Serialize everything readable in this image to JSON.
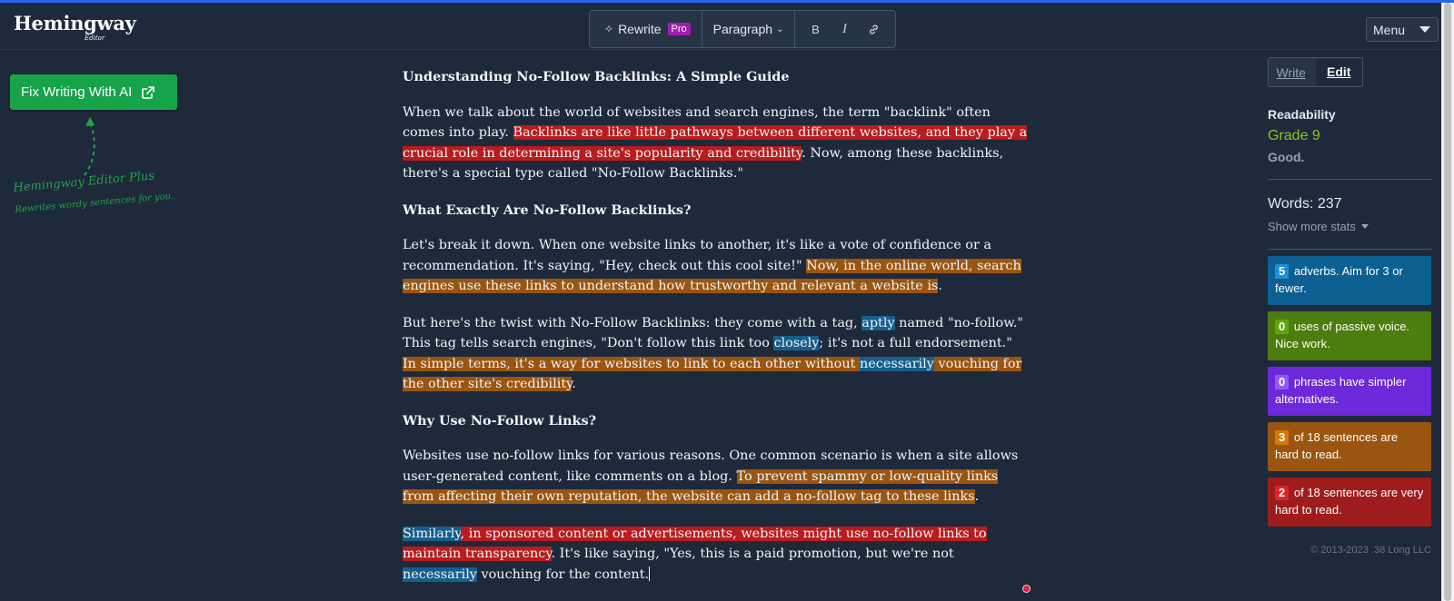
{
  "header": {
    "logo": "Hemingway",
    "logo_sub": "Editor",
    "toolbar": {
      "rewrite_label": "Rewrite",
      "pro_badge": "Pro",
      "paragraph_label": "Paragraph",
      "bold_label": "B",
      "italic_label": "I"
    },
    "menu_label": "Menu"
  },
  "left_panel": {
    "fix_button_label": "Fix Writing With AI",
    "plus_title": "Hemingway Editor Plus",
    "plus_subtitle": "Rewrites wordy sentences for you."
  },
  "document": {
    "title": "Understanding No-Follow Backlinks: A Simple Guide",
    "p1": {
      "a": "When we talk about the world of websites and search engines, the term \"backlink\" often comes into play. ",
      "b": "Backlinks are like little pathways between different websites, and they play a crucial role in determining a site's popularity and credibility",
      "c": ". Now, among these backlinks, there's a special type called \"No-Follow Backlinks.\""
    },
    "h2": "What Exactly Are No-Follow Backlinks?",
    "p2": {
      "a": "Let's break it down. When one website links to another, it's like a vote of confidence or a recommendation. It's saying, \"Hey, check out this cool site!\" ",
      "b": "Now, in the online world, search engines use these links to understand how trustworthy and relevant a website is",
      "c": "."
    },
    "p3": {
      "a": "But here's the twist with No-Follow Backlinks: they come with a tag, ",
      "b": "aptly",
      "c": " named \"no-follow.\" This tag tells search engines, \"Don't follow this link too ",
      "d": "closely",
      "e": "; it's not a full endorsement.\" ",
      "f": "In simple terms, it's a way for websites to link to each other without ",
      "g": "necessarily",
      "h": " vouching for the other site's credibility",
      "i": "."
    },
    "h3": "Why Use No-Follow Links?",
    "p4": {
      "a": "Websites use no-follow links for various reasons. One common scenario is when a site allows user-generated content, like comments on a blog. ",
      "b": "To prevent spammy or low-quality links from affecting their own reputation, the website can add a no-follow tag to these links",
      "c": "."
    },
    "p5": {
      "a": "Similarly",
      "b": ", in sponsored content or advertisements, websites might use no-follow links to maintain transparency",
      "c": ". It's like saying, \"Yes, this is a paid promotion, but we're not ",
      "d": "necessarily",
      "e": " vouching for the content."
    }
  },
  "sidebar": {
    "mode_write": "Write",
    "mode_edit": "Edit",
    "readability_label": "Readability",
    "grade": "Grade 9",
    "grade_desc": "Good.",
    "words": "Words: 237",
    "show_more": "Show more stats",
    "stats": [
      {
        "num": "5",
        "text": "adverbs. Aim for 3 or fewer."
      },
      {
        "num": "0",
        "text": "uses of passive voice. Nice work."
      },
      {
        "num": "0",
        "text": "phrases have simpler alternatives."
      },
      {
        "num": "3",
        "text": "of 18 sentences are hard to read."
      },
      {
        "num": "2",
        "text": "of 18 sentences are very hard to read."
      }
    ],
    "copyright": "© 2013-2023 .38 Long LLC"
  },
  "colors": {
    "background": "#1e293b",
    "very_hard": "#b91c1c",
    "hard": "#9a5511",
    "adverb": "#165e8c",
    "passive": "#4d7c0f",
    "phrase": "#6d28d9",
    "accent_green": "#16a34a"
  },
  "icons": [
    "sparkle-icon",
    "chevron-down-icon",
    "link-icon",
    "external-link-icon",
    "caret-down-icon"
  ]
}
